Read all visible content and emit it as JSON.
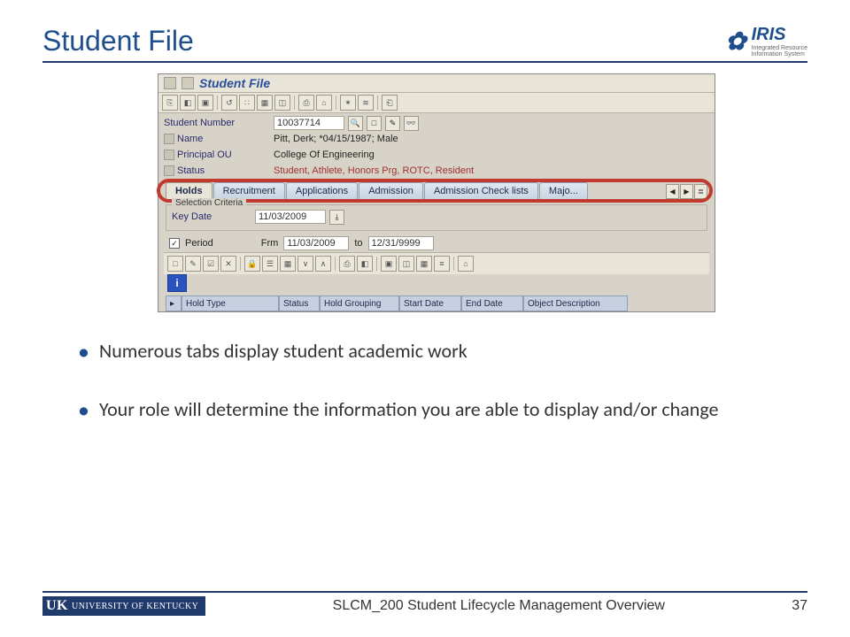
{
  "header": {
    "title": "Student File",
    "logo_label": "IRIS",
    "logo_sub1": "Integrated Resource",
    "logo_sub2": "Information System"
  },
  "sap": {
    "window_title": "Student File",
    "fields": {
      "student_number_label": "Student Number",
      "student_number_value": "10037714",
      "name_label": "Name",
      "name_value": "Pitt, Derk; *04/15/1987; Male",
      "principal_ou_label": "Principal OU",
      "principal_ou_value": "College Of Engineering",
      "status_label": "Status",
      "status_value": "Student, Athlete, Honors Prg, ROTC, Resident"
    },
    "tabs": [
      "Holds",
      "Recruitment",
      "Applications",
      "Admission",
      "Admission Check lists",
      "Majo..."
    ],
    "selection_criteria_label": "Selection Criteria",
    "key_date_label": "Key Date",
    "key_date_value": "11/03/2009",
    "period_label": "Period",
    "frm_label": "Frm",
    "frm_value": "11/03/2009",
    "to_label": "to",
    "to_value": "12/31/9999",
    "grid_headers": [
      "Hold Type",
      "Status",
      "Hold Grouping",
      "Start Date",
      "End Date",
      "Object Description"
    ]
  },
  "bullets": [
    "Numerous tabs display student academic work",
    "Your role will determine the information you are able to display and/or change"
  ],
  "footer": {
    "org_prefix": "UK",
    "org_name": "UNIVERSITY OF KENTUCKY",
    "center": "SLCM_200 Student Lifecycle Management Overview",
    "page": "37"
  }
}
